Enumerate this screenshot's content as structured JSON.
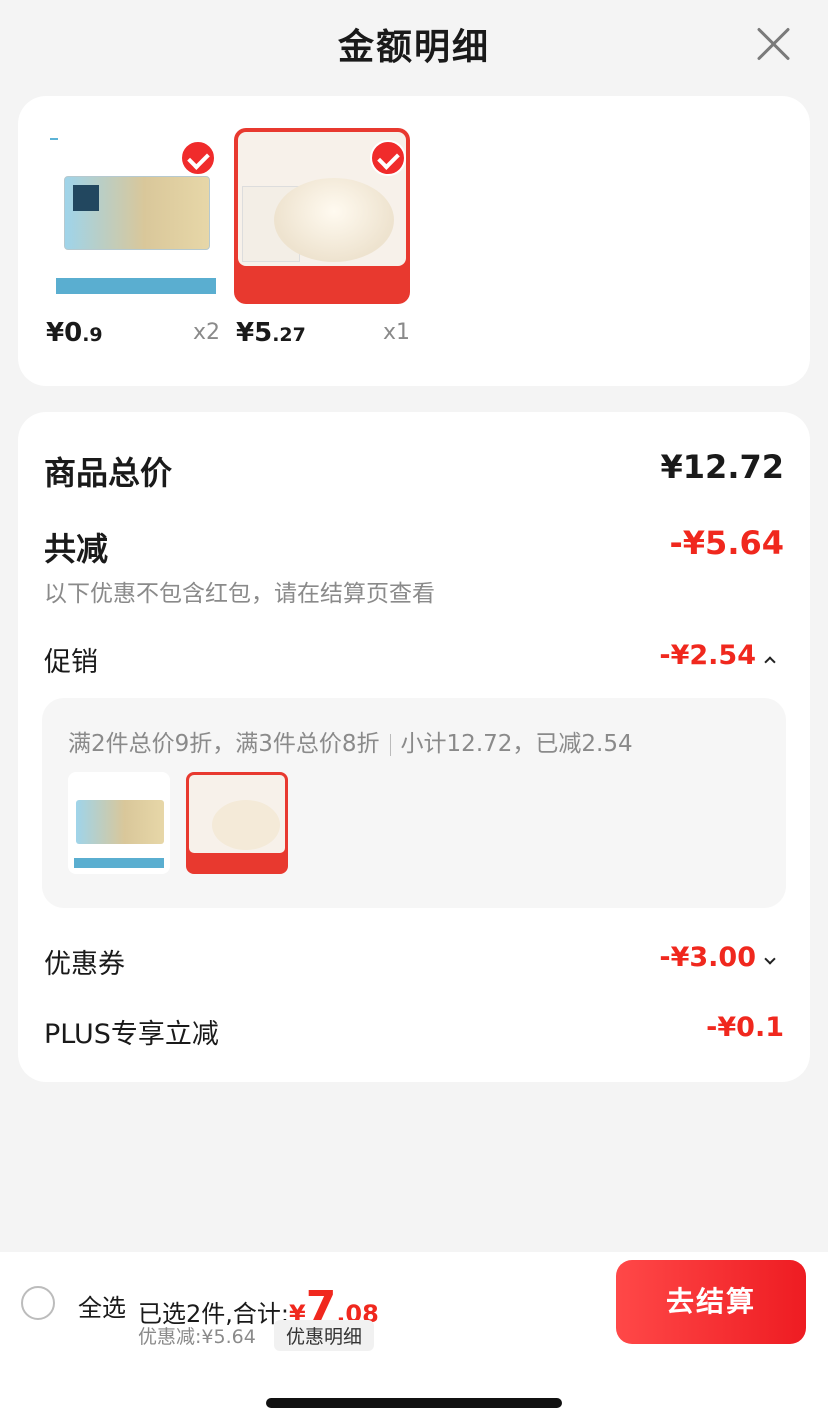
{
  "header": {
    "title": "金额明细"
  },
  "products": [
    {
      "price_int": "¥0",
      "price_dec": ".9",
      "qty": "x2"
    },
    {
      "price_int": "¥5",
      "price_dec": ".27",
      "qty": "x1"
    }
  ],
  "summary": {
    "total_label": "商品总价",
    "total_value": "¥12.72",
    "reduce_label": "共减",
    "reduce_value": "-¥5.64",
    "reduce_note": "以下优惠不包含红包，请在结算页查看",
    "promo_label": "促销",
    "promo_value": "-¥2.54",
    "promo_desc": "满2件总价9折，满3件总价8折",
    "promo_subtotal": "小计12.72，已减2.54",
    "coupon_label": "优惠券",
    "coupon_value": "-¥3.00",
    "plus_label": "PLUS专享立减",
    "plus_value": "-¥0.1"
  },
  "footer": {
    "select_all": "全选",
    "selected_text": "已选2件,合计:",
    "total_yen": "¥",
    "total_int": "7",
    "total_dec": ".08",
    "discount_text": "优惠减:¥5.64",
    "detail_button": "优惠明细",
    "pay_button": "去结算"
  },
  "colors": {
    "accent": "#f0281e",
    "background": "#f4f4f4"
  }
}
